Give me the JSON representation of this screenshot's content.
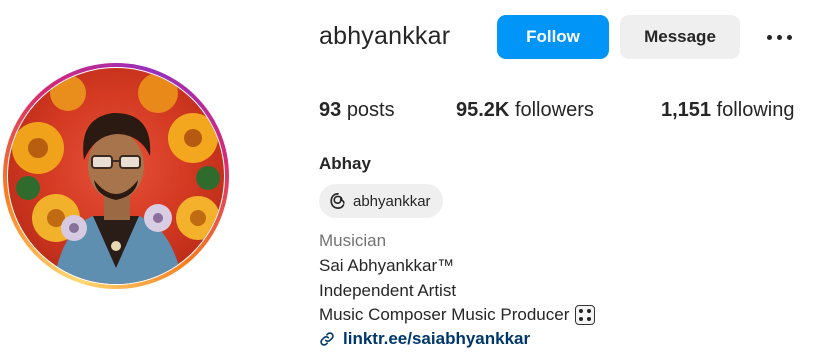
{
  "profile": {
    "username": "abhyankkar",
    "name": "Abhay",
    "avatar_icon": "profile-photo"
  },
  "actions": {
    "follow_label": "Follow",
    "message_label": "Message",
    "more_icon": "more-horizontal-icon"
  },
  "stats": {
    "posts_count": "93",
    "posts_label": "posts",
    "followers_count": "95.2K",
    "followers_label": "followers",
    "following_count": "1,151",
    "following_label": "following"
  },
  "threads": {
    "icon": "threads-icon",
    "handle": "abhyankkar"
  },
  "bio": {
    "category": "Musician",
    "line1": "Sai Abhyankkar™",
    "line2": "Independent Artist",
    "line3": "Music Composer Music Producer",
    "line3_emoji": "game-die-icon"
  },
  "link": {
    "icon": "link-icon",
    "text": "linktr.ee/saiabhyankkar"
  },
  "colors": {
    "follow_blue": "#0095f6",
    "message_grey": "#efefef",
    "link_blue": "#00376b",
    "category_grey": "#737373"
  }
}
